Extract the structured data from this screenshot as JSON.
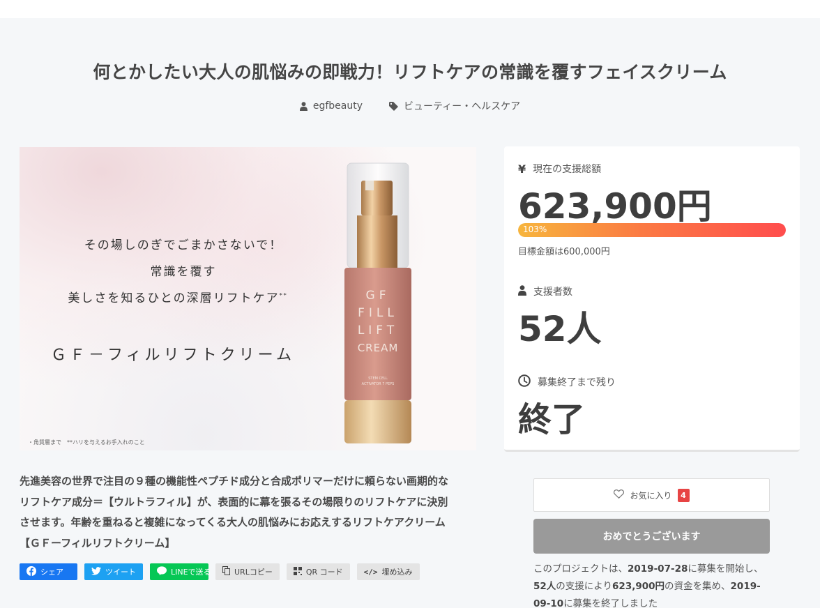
{
  "project": {
    "title": "何とかしたい大人の肌悩みの即戦力！リフトケアの常識を覆すフェイスクリーム",
    "author": "egfbeauty",
    "category": "ビューティー・ヘルスケア"
  },
  "hero": {
    "copy_line1": "その場しのぎでごまかさないで！",
    "copy_line2": "常識を覆す",
    "copy_line3": "美しさを知るひとの深層リフトケア",
    "copy_mark": "**",
    "product_name": "ＧＦ－フィルリフトクリーム",
    "footnote": "・角質層まで　**ハリを与えるお手入れのこと",
    "bottle_label": [
      "GF",
      "FILL",
      "LIFT",
      "CREAM"
    ],
    "bottle_sublabel": [
      "STEM CELL",
      "ACTIVATOR 7 PEPS"
    ]
  },
  "stats": {
    "funding_label": "現在の支援総額",
    "funding_amount": "623,900円",
    "progress_percent": 103,
    "progress_label": "103%",
    "goal_text": "目標金額は600,000円",
    "supporters_label": "支援者数",
    "supporters_value": "52人",
    "remaining_label": "募集終了まで残り",
    "remaining_value": "終了"
  },
  "description": {
    "line1": "先進美容の世界で注目の９種の機能性ペプチド成分と合成ポリマーだけに頼らない画期的な",
    "line2": "リフトケア成分＝【ウルトラフィル】が、表面的に幕を張るその場限りのリフトケアに決別",
    "line3": "させます。年齢を重ねると複雑になってくる大人の肌悩みにお応えするリフトケアクリーム",
    "line4": "【ＧＦーフィルリフトクリーム】"
  },
  "share": {
    "facebook": "シェア",
    "twitter": "ツイート",
    "line": "LINEで送る",
    "url_copy": "URLコピー",
    "qr": "QR コード",
    "embed": "埋め込み"
  },
  "favorite": {
    "label": "お気に入り",
    "count": "4"
  },
  "cta": {
    "label": "おめでとうございます"
  },
  "summary": {
    "p1": "このプロジェクトは、",
    "start_date": "2019-07-28",
    "p2": "に募集を開始し、",
    "supporters": "52人",
    "p3": "の支援により",
    "amount": "623,900円",
    "p4": "の資金を集め、",
    "end_date": "2019-09-10",
    "p5": "に募集を終了しました"
  },
  "colors": {
    "progress_start": "#f7b53d",
    "progress_end": "#ff4d4d",
    "badge": "#e74444",
    "facebook": "#1877f2",
    "twitter": "#1da1f2",
    "line": "#06c755",
    "cta_disabled": "#9a9a9a"
  }
}
